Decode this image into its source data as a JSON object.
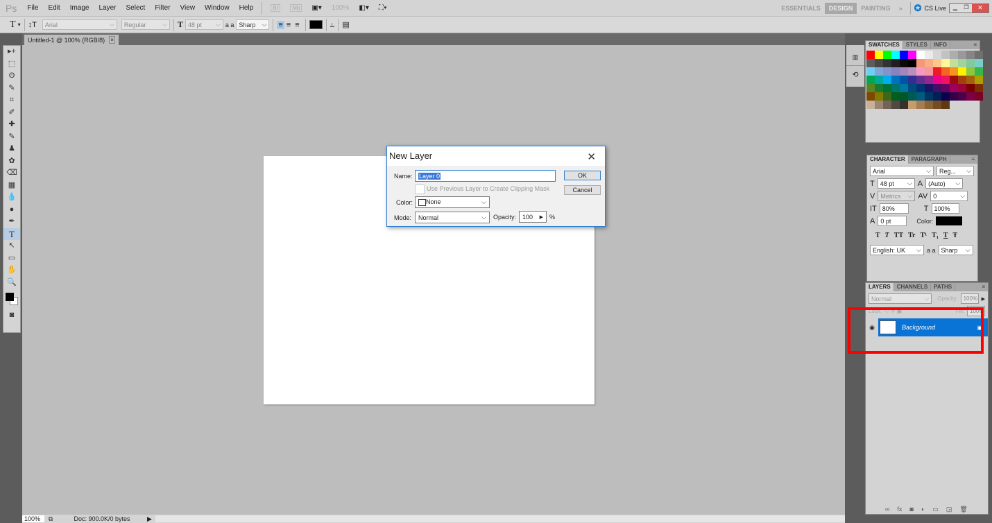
{
  "menubar": {
    "logo": "Ps",
    "items": [
      "File",
      "Edit",
      "Image",
      "Layer",
      "Select",
      "Filter",
      "View",
      "Window",
      "Help"
    ],
    "icons": [
      "bridge-icon",
      "mini-bridge-icon",
      "screen-mode-icon"
    ],
    "zoom": "100%",
    "workspaces": [
      "ESSENTIALS",
      "DESIGN",
      "PAINTING"
    ],
    "active_workspace": "DESIGN",
    "more": "»",
    "cs_live": "CS Live"
  },
  "options": {
    "tool": "T",
    "font": "Arial",
    "style": "Regular",
    "size": "48 pt",
    "aa": "Sharp",
    "aa_label": "a a",
    "color": "#000000"
  },
  "document": {
    "tab": "Untitled-1 @ 100% (RGB/8)",
    "close": "×"
  },
  "tools": [
    "▸+",
    "⬚",
    "ʘ",
    "✎",
    "⌗",
    "✐",
    "✚",
    "✎",
    "♟",
    "✿",
    "⌫",
    "▦",
    "💧",
    "●",
    "✒",
    "T",
    "↖",
    "▭",
    "✋",
    "🔍"
  ],
  "status": {
    "zoom": "100%",
    "doc": "Doc: 900.0K/0 bytes"
  },
  "swatches": {
    "tabs": [
      "SWATCHES",
      "STYLES",
      "INFO"
    ],
    "colors": [
      "#ff0000",
      "#ffff00",
      "#00ff00",
      "#00ffff",
      "#0000ff",
      "#ff00ff",
      "#ffffff",
      "#ebebeb",
      "#d6d6d6",
      "#c2c2c2",
      "#adadad",
      "#999999",
      "#858585",
      "#707070",
      "#5c5c5c",
      "#474747",
      "#333333",
      "#1f1f1f",
      "#0a0a0a",
      "#000000",
      "#f7977a",
      "#f9ad81",
      "#fdc68a",
      "#fff79a",
      "#c4df9b",
      "#a2d39c",
      "#82ca9d",
      "#7bcdc8",
      "#6ecff6",
      "#7ea7d8",
      "#8493ca",
      "#8882be",
      "#a187be",
      "#bc8dbf",
      "#f49ac2",
      "#f6989d",
      "#ed1c24",
      "#f26522",
      "#f7941d",
      "#fff200",
      "#8dc73f",
      "#39b54a",
      "#00a651",
      "#00a99d",
      "#00aeef",
      "#0072bc",
      "#0054a6",
      "#2e3192",
      "#662d91",
      "#92278f",
      "#ec008c",
      "#ed145b",
      "#9e0b0f",
      "#a0410d",
      "#a3620a",
      "#aba000",
      "#598527",
      "#197b30",
      "#007236",
      "#00746b",
      "#0076a3",
      "#004a80",
      "#003471",
      "#1b1464",
      "#440e62",
      "#630460",
      "#9e005d",
      "#9e0039",
      "#790000",
      "#7b2e00",
      "#7d4900",
      "#827b00",
      "#406618",
      "#005e20",
      "#005826",
      "#005952",
      "#005b7f",
      "#003663",
      "#002157",
      "#0d004c",
      "#32004b",
      "#4b0049",
      "#7b0046",
      "#7a0026",
      "#c7b299",
      "#998675",
      "#736357",
      "#534741",
      "#37302d",
      "#c69c6d",
      "#a67c52",
      "#8c6239",
      "#754c24",
      "#603913"
    ]
  },
  "character": {
    "tabs": [
      "CHARACTER",
      "PARAGRAPH"
    ],
    "font": "Arial",
    "style": "Reg...",
    "size": "48 pt",
    "leading": "(Auto)",
    "kerning": "Metrics",
    "tracking": "0",
    "vscale": "80%",
    "hscale": "100%",
    "baseline": "0 pt",
    "color_label": "Color:",
    "styles": [
      "T",
      "T",
      "TT",
      "Tr",
      "T¹",
      "T₁",
      "T",
      "Ŧ"
    ],
    "language": "English: UK",
    "aa_label": "a a",
    "aa": "Sharp"
  },
  "layers": {
    "tabs": [
      "LAYERS",
      "CHANNELS",
      "PATHS"
    ],
    "blend": "Normal",
    "opacity_label": "Opacity:",
    "opacity": "100%",
    "lock_label": "Lock:",
    "fill_label": "Fill:",
    "fill": "100%",
    "items": [
      {
        "name": "Background",
        "selected": true
      }
    ],
    "footer_icons": [
      "link-icon",
      "fx-icon",
      "mask-icon",
      "adjustment-icon",
      "folder-icon",
      "new-layer-icon",
      "trash-icon"
    ],
    "highlight_color": "#ff0000"
  },
  "dialog": {
    "title": "New Layer",
    "close": "✕",
    "name_label": "Name:",
    "name": "Layer 0",
    "clip_label": "Use Previous Layer to Create Clipping Mask",
    "color_label": "Color:",
    "color": "None",
    "mode_label": "Mode:",
    "mode": "Normal",
    "opacity_label": "Opacity:",
    "opacity": "100",
    "percent": "%",
    "ok": "OK",
    "cancel": "Cancel"
  }
}
